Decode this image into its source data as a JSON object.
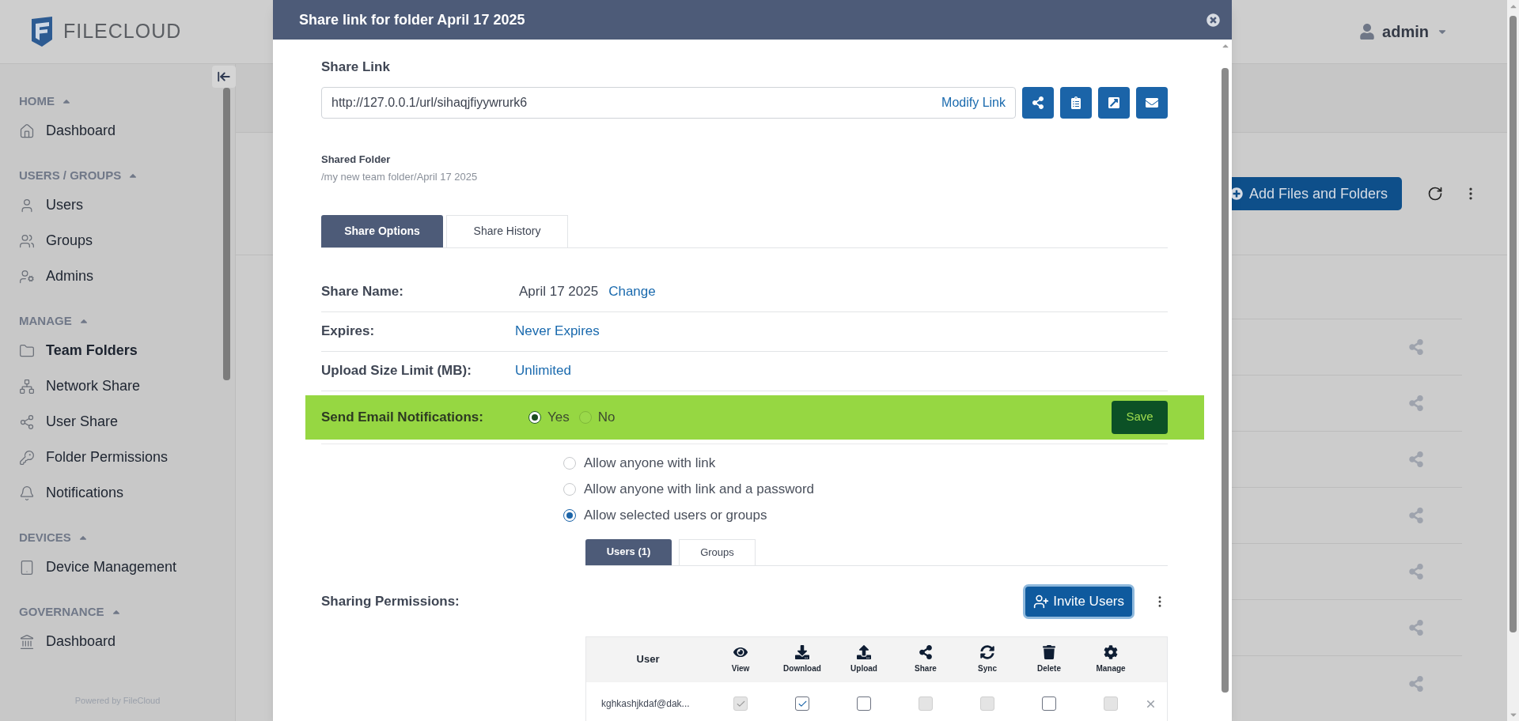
{
  "header": {
    "logo_text": "FILECLOUD",
    "user": "admin"
  },
  "sidebar": {
    "sections": [
      {
        "title": "HOME",
        "expanded": true,
        "items": [
          {
            "label": "Dashboard",
            "selected": false
          }
        ]
      },
      {
        "title": "USERS / GROUPS",
        "expanded": true,
        "items": [
          {
            "label": "Users",
            "selected": false
          },
          {
            "label": "Groups",
            "selected": false
          },
          {
            "label": "Admins",
            "selected": false
          }
        ]
      },
      {
        "title": "MANAGE",
        "expanded": true,
        "items": [
          {
            "label": "Team Folders",
            "selected": true
          },
          {
            "label": "Network Share",
            "selected": false
          },
          {
            "label": "User Share",
            "selected": false
          },
          {
            "label": "Folder Permissions",
            "selected": false
          },
          {
            "label": "Notifications",
            "selected": false
          }
        ]
      },
      {
        "title": "DEVICES",
        "expanded": true,
        "items": [
          {
            "label": "Device Management",
            "selected": false
          }
        ]
      },
      {
        "title": "GOVERNANCE",
        "expanded": true,
        "items": [
          {
            "label": "Dashboard",
            "selected": false
          }
        ]
      }
    ],
    "footer": "Powered by FileCloud"
  },
  "background": {
    "add_button": "Add Files and Folders",
    "rows": [
      {
        "kind": "share-row"
      },
      {
        "kind": "share-row"
      },
      {
        "kind": "share-row"
      },
      {
        "kind": "share-row"
      },
      {
        "kind": "share-row"
      },
      {
        "kind": "share-row"
      },
      {
        "kind": "share-row"
      }
    ]
  },
  "modal": {
    "title": "Share link for folder April 17 2025",
    "share_link_label": "Share Link",
    "url": "http://127.0.0.1/url/sihaqjfiyywrurk6",
    "modify_link": "Modify Link",
    "shared_folder_label": "Shared Folder",
    "shared_folder_path": "/my new team folder/April 17 2025",
    "tabs": [
      {
        "label": "Share Options",
        "selected": true
      },
      {
        "label": "Share History",
        "selected": false
      }
    ],
    "fields": [
      {
        "label": "Share Name:",
        "value": "April 17 2025",
        "link": "Change"
      },
      {
        "label": "Expires:",
        "link": "Never Expires"
      },
      {
        "label": "Upload Size Limit (MB):",
        "link": "Unlimited"
      }
    ],
    "notifications": {
      "label": "Send Email Notifications:",
      "options": [
        {
          "label": "Yes",
          "selected": true
        },
        {
          "label": "No",
          "selected": false
        }
      ],
      "save": "Save"
    },
    "access_options": [
      {
        "label": "Allow anyone with link",
        "selected": false
      },
      {
        "label": "Allow anyone with link and a password",
        "selected": false
      },
      {
        "label": "Allow selected users or groups",
        "selected": true
      }
    ],
    "user_tabs": [
      {
        "label": "Users (1)",
        "selected": true
      },
      {
        "label": "Groups",
        "selected": false
      }
    ],
    "sharing_permissions_label": "Sharing Permissions:",
    "invite_button": "Invite Users",
    "table": {
      "columns": [
        "User",
        "View",
        "Download",
        "Upload",
        "Share",
        "Sync",
        "Delete",
        "Manage"
      ],
      "rows": [
        {
          "user": "kghkashjkdaf@dak...",
          "permissions": [
            {
              "checked": true,
              "disabled": true
            },
            {
              "checked": true,
              "disabled": false
            },
            {
              "checked": false,
              "disabled": false
            },
            {
              "checked": false,
              "disabled": true
            },
            {
              "checked": false,
              "disabled": true
            },
            {
              "checked": false,
              "disabled": false
            },
            {
              "checked": false,
              "disabled": true
            }
          ]
        }
      ]
    }
  }
}
